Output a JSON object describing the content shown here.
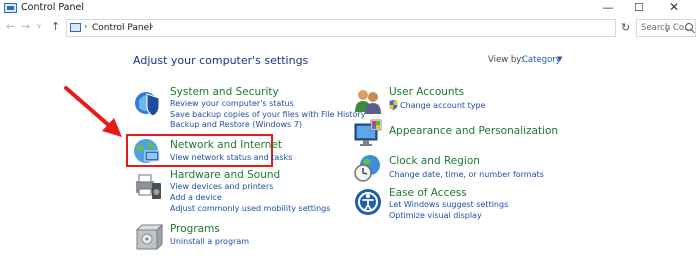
{
  "window": {
    "title": "Control Panel",
    "minimize": "—",
    "maximize": "☐",
    "close": "✕"
  },
  "nav": {
    "back": "←",
    "forward": "→",
    "recent": "∨",
    "up": "↑",
    "separator": "›",
    "breadcrumb": "Control Panel",
    "dropdown": "∨",
    "refresh": "↻",
    "search_placeholder": "Search Co..."
  },
  "main": {
    "heading": "Adjust your computer's settings",
    "view_by_label": "View by:",
    "view_by_value": "Category",
    "view_by_caret": "▼"
  },
  "categories_left": [
    {
      "title": "System and Security",
      "icon": "system-security-shield-icon",
      "links": [
        "Review your computer's status",
        "Save backup copies of your files with File History",
        "Backup and Restore (Windows 7)"
      ]
    },
    {
      "title": "Network and Internet",
      "icon": "network-globe-icon",
      "links": [
        "View network status and tasks"
      ]
    },
    {
      "title": "Hardware and Sound",
      "icon": "printer-speaker-icon",
      "links": [
        "View devices and printers",
        "Add a device",
        "Adjust commonly used mobility settings"
      ]
    },
    {
      "title": "Programs",
      "icon": "programs-box-icon",
      "links": [
        "Uninstall a program"
      ]
    }
  ],
  "categories_right": [
    {
      "title": "User Accounts",
      "icon": "users-icon",
      "links": [
        "Change account type"
      ]
    },
    {
      "title": "Appearance and Personalization",
      "icon": "monitor-palette-icon",
      "links": []
    },
    {
      "title": "Clock and Region",
      "icon": "clock-globe-icon",
      "links": [
        "Change date, time, or number formats"
      ]
    },
    {
      "title": "Ease of Access",
      "icon": "ease-of-access-icon",
      "links": [
        "Let Windows suggest settings",
        "Optimize visual display"
      ]
    }
  ],
  "colors": {
    "category_title": "#1d7a2f",
    "link": "#1e4fa8",
    "annotation": "#e41c1c"
  }
}
